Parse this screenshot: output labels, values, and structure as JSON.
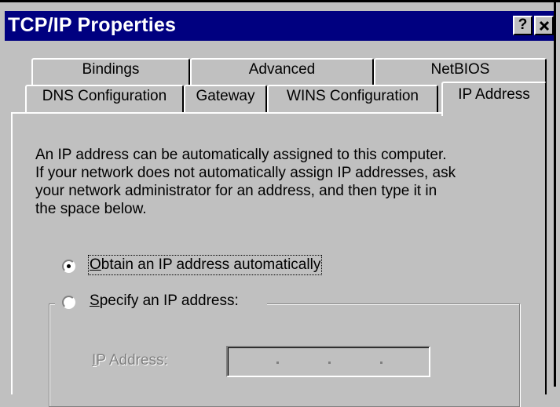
{
  "window": {
    "title": "TCP/IP Properties",
    "help_label": "?",
    "close_label": "×"
  },
  "tabs_row1": [
    {
      "label": "Bindings"
    },
    {
      "label": "Advanced"
    },
    {
      "label": "NetBIOS"
    }
  ],
  "tabs_row2": [
    {
      "label": "DNS Configuration"
    },
    {
      "label": "Gateway"
    },
    {
      "label": "WINS Configuration"
    },
    {
      "label": "IP Address",
      "active": true
    }
  ],
  "ip_tab": {
    "description_lines": [
      "An IP address can be automatically assigned to this computer.",
      "If your network does not automatically assign IP addresses, ask",
      "your network administrator for an address, and then type it in",
      "the space below."
    ],
    "obtain_auto": {
      "mnemonic": "O",
      "rest": "btain an IP address automatically",
      "selected": true
    },
    "specify": {
      "mnemonic": "S",
      "rest": "pecify an IP address:",
      "selected": false
    },
    "ip_address_label": {
      "mnemonic": "I",
      "rest": "P Address:"
    },
    "ip_address_value": [
      "",
      "",
      "",
      ""
    ]
  },
  "colors": {
    "titlebar": "#000080",
    "face": "#c0c0c0",
    "disabled_text": "#808080"
  }
}
